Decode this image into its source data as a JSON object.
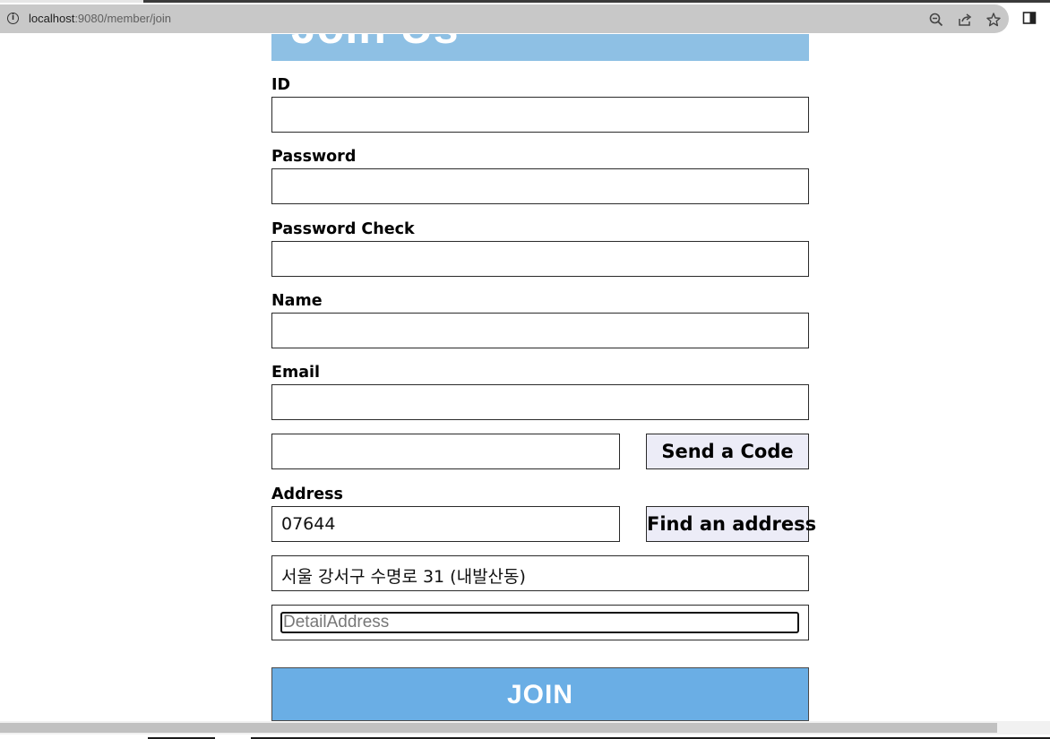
{
  "browser": {
    "url_host": "localhost",
    "url_path": ":9080/member/join",
    "icons": [
      "info-icon",
      "zoom-icon",
      "share-icon",
      "star-icon",
      "sidepanel-icon"
    ]
  },
  "banner": {
    "title": "Join Us",
    "color": "#8ec0e4"
  },
  "form": {
    "id_label": "ID",
    "password_label": "Password",
    "password_check_label": "Password Check",
    "name_label": "Name",
    "email_label": "Email",
    "send_code_label": "Send a Code",
    "address_label": "Address",
    "zipcode_value": "07644",
    "find_address_label": "Find an address",
    "address_value": "서울 강서구 수명로 31 (내발산동)",
    "detail_placeholder": "DetailAddress",
    "join_label": "JOIN",
    "join_color": "#6aaee5"
  }
}
